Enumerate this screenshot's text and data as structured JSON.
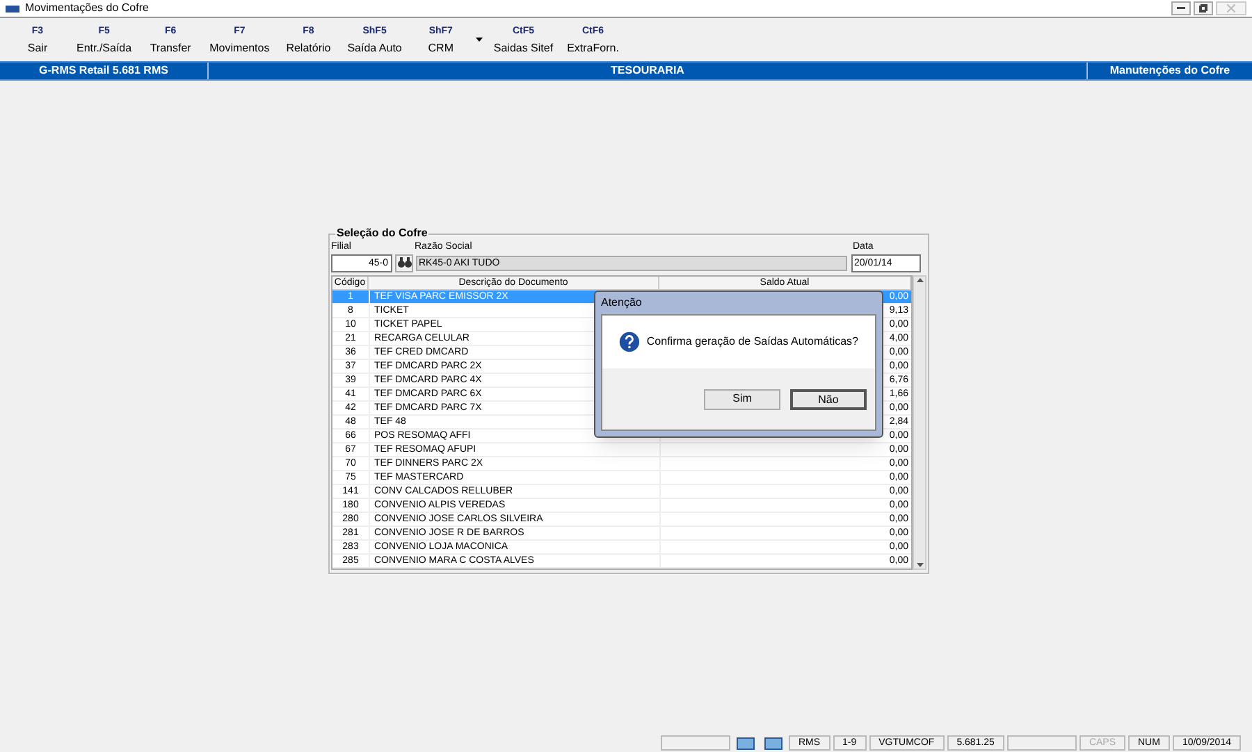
{
  "window": {
    "title": "Movimentações do Cofre"
  },
  "toolbar": [
    {
      "key": "F3",
      "label": "Sair"
    },
    {
      "key": "F5",
      "label": "Entr./Saída"
    },
    {
      "key": "F6",
      "label": "Transfer"
    },
    {
      "key": "F7",
      "label": "Movimentos"
    },
    {
      "key": "F8",
      "label": "Relatório"
    },
    {
      "key": "ShF5",
      "label": "Saída Auto"
    },
    {
      "key": "ShF7",
      "label": "CRM",
      "dropdown": true
    },
    {
      "key": "CtF5",
      "label": "Saidas Sitef"
    },
    {
      "key": "CtF6",
      "label": "ExtraForn."
    }
  ],
  "header_bar": {
    "left": "G-RMS Retail 5.681 RMS",
    "center": "TESOURARIA",
    "right": "Manutenções do Cofre"
  },
  "group": {
    "title": "Seleção do Cofre",
    "filial_label": "Filial",
    "filial": "45-0",
    "razao_label": "Razão Social",
    "razao": "RK45-0 AKI TUDO",
    "data_label": "Data",
    "data": "20/01/14",
    "table": {
      "columns": [
        "Código",
        "Descrição do Documento",
        "Saldo Atual"
      ],
      "rows": [
        {
          "codigo": "1",
          "descricao": "TEF VISA PARC EMISSOR 2X",
          "saldo": "0,00",
          "selected": true
        },
        {
          "codigo": "8",
          "descricao": "TICKET",
          "saldo": "9,13",
          "selected": false
        },
        {
          "codigo": "10",
          "descricao": "TICKET PAPEL",
          "saldo": "0,00",
          "selected": false
        },
        {
          "codigo": "21",
          "descricao": "RECARGA CELULAR",
          "saldo": "4,00",
          "selected": false
        },
        {
          "codigo": "36",
          "descricao": "TEF CRED DMCARD",
          "saldo": "0,00",
          "selected": false
        },
        {
          "codigo": "37",
          "descricao": "TEF DMCARD PARC 2X",
          "saldo": "0,00",
          "selected": false
        },
        {
          "codigo": "39",
          "descricao": "TEF DMCARD PARC 4X",
          "saldo": "6,76",
          "selected": false
        },
        {
          "codigo": "41",
          "descricao": "TEF DMCARD PARC 6X",
          "saldo": "1,66",
          "selected": false
        },
        {
          "codigo": "42",
          "descricao": "TEF DMCARD PARC 7X",
          "saldo": "0,00",
          "selected": false
        },
        {
          "codigo": "48",
          "descricao": "TEF 48",
          "saldo": "2,84",
          "selected": false
        },
        {
          "codigo": "66",
          "descricao": "POS RESOMAQ AFFI",
          "saldo": "0,00",
          "selected": false
        },
        {
          "codigo": "67",
          "descricao": "TEF RESOMAQ AFUPI",
          "saldo": "0,00",
          "selected": false
        },
        {
          "codigo": "70",
          "descricao": "TEF DINNERS PARC 2X",
          "saldo": "0,00",
          "selected": false
        },
        {
          "codigo": "75",
          "descricao": "TEF MASTERCARD",
          "saldo": "0,00",
          "selected": false
        },
        {
          "codigo": "141",
          "descricao": "CONV CALCADOS RELLUBER",
          "saldo": "0,00",
          "selected": false
        },
        {
          "codigo": "180",
          "descricao": "CONVENIO ALPIS VEREDAS",
          "saldo": "0,00",
          "selected": false
        },
        {
          "codigo": "280",
          "descricao": "CONVENIO JOSE CARLOS SILVEIRA",
          "saldo": "0,00",
          "selected": false
        },
        {
          "codigo": "281",
          "descricao": "CONVENIO JOSE R DE BARROS",
          "saldo": "0,00",
          "selected": false
        },
        {
          "codigo": "283",
          "descricao": "CONVENIO LOJA MACONICA",
          "saldo": "0,00",
          "selected": false
        },
        {
          "codigo": "285",
          "descricao": "CONVENIO MARA C COSTA ALVES",
          "saldo": "0,00",
          "selected": false
        }
      ]
    }
  },
  "dialog": {
    "title": "Atenção",
    "message": "Confirma geração de Saídas Automáticas?",
    "buttons": [
      {
        "label": "Sim",
        "default": false
      },
      {
        "label": "Não",
        "default": true
      }
    ]
  },
  "status_bar": [
    {
      "kind": "empty"
    },
    {
      "kind": "icon"
    },
    {
      "kind": "icon"
    },
    {
      "kind": "text",
      "text": "RMS",
      "on": true
    },
    {
      "kind": "text",
      "text": "1-9",
      "on": true
    },
    {
      "kind": "text",
      "text": "VGTUMCOF",
      "on": true
    },
    {
      "kind": "text",
      "text": "5.681.25",
      "on": true
    },
    {
      "kind": "empty"
    },
    {
      "kind": "text",
      "text": "CAPS",
      "on": false
    },
    {
      "kind": "text",
      "text": "NUM",
      "on": true
    },
    {
      "kind": "text",
      "text": "10/09/2014",
      "on": true
    }
  ]
}
